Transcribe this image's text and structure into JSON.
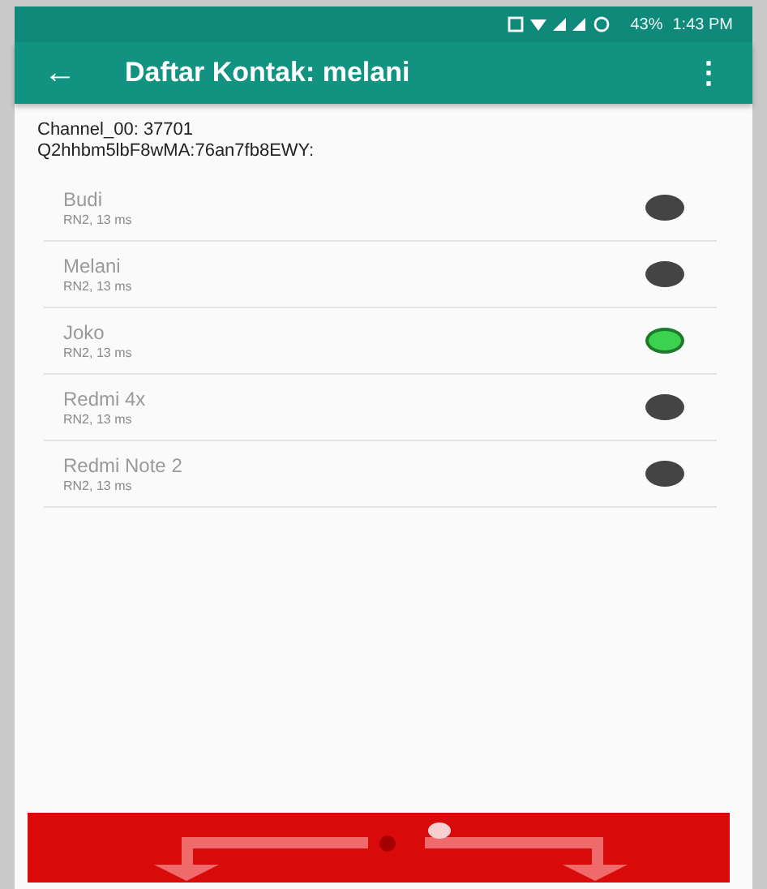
{
  "status_bar": {
    "battery": "43%",
    "time": "1:43 PM"
  },
  "toolbar": {
    "back": "←",
    "title": "Daftar Kontak: melani",
    "menu": "⋮"
  },
  "channel_info": [
    "Channel_00: 37701",
    "Q2hhbm5lbF8wMA:76an7fb8EWY:"
  ],
  "contacts": [
    {
      "name": "Budi",
      "detail": "RN2, 13 ms",
      "active": false
    },
    {
      "name": "Melani",
      "detail": "RN2, 13 ms",
      "active": false
    },
    {
      "name": "Joko",
      "detail": "RN2, 13 ms",
      "active": true
    },
    {
      "name": "Redmi 4x",
      "detail": "RN2, 13 ms",
      "active": false
    },
    {
      "name": "Redmi Note 2",
      "detail": "RN2, 13 ms",
      "active": false
    }
  ]
}
